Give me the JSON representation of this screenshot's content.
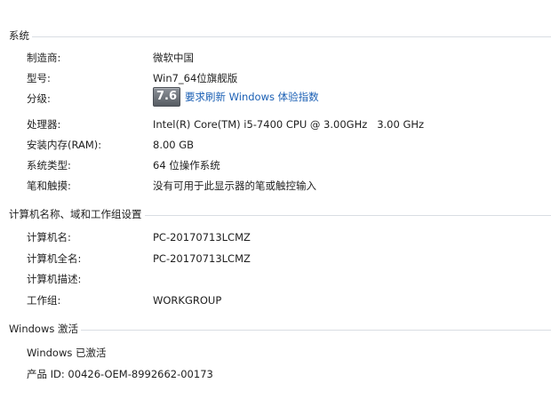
{
  "system": {
    "heading": "系统",
    "manufacturer_label": "制造商:",
    "manufacturer_value": "微软中国",
    "model_label": "型号:",
    "model_value": "Win7_64位旗舰版",
    "rating_label": "分级:",
    "rating_score": "7.6",
    "rating_link": "要求刷新 Windows 体验指数",
    "processor_label": "处理器:",
    "processor_value": "Intel(R) Core(TM) i5-7400 CPU @ 3.00GHz   3.00 GHz",
    "ram_label": "安装内存(RAM):",
    "ram_value": "8.00 GB",
    "type_label": "系统类型:",
    "type_value": "64 位操作系统",
    "pen_label": "笔和触摸:",
    "pen_value": "没有可用于此显示器的笔或触控输入"
  },
  "computer": {
    "heading": "计算机名称、域和工作组设置",
    "name_label": "计算机名:",
    "name_value": "PC-20170713LCMZ",
    "fullname_label": "计算机全名:",
    "fullname_value": "PC-20170713LCMZ",
    "desc_label": "计算机描述:",
    "desc_value": "",
    "workgroup_label": "工作组:",
    "workgroup_value": "WORKGROUP"
  },
  "activation": {
    "heading": "Windows 激活",
    "status": "Windows 已激活",
    "product_id": "产品 ID: 00426-OEM-8992662-00173"
  },
  "colors": {
    "link": "#1a5fb4",
    "rule": "#d9dde3",
    "badge": "#6b7077"
  }
}
